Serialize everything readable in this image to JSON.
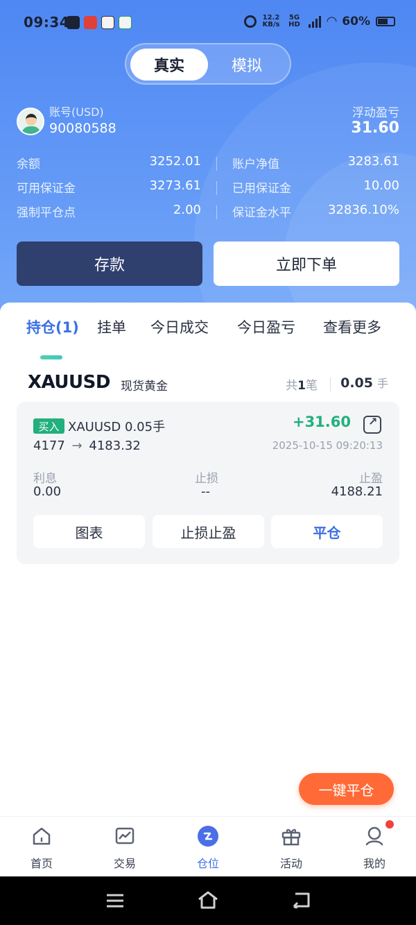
{
  "status_bar": {
    "time": "09:34",
    "speed_top": "12.2",
    "speed_unit": "KB/s",
    "network": "5G HD",
    "battery": "60%"
  },
  "mode_toggle": {
    "active": "真实",
    "inactive": "模拟"
  },
  "account": {
    "label": "账号(USD)",
    "number": "90080588",
    "floating_pnl_label": "浮动盈亏",
    "floating_pnl_value": "31.60"
  },
  "stats": [
    {
      "left_label": "余额",
      "left_value": "3252.01",
      "right_label": "账户净值",
      "right_value": "3283.61"
    },
    {
      "left_label": "可用保证金",
      "left_value": "3273.61",
      "right_label": "已用保证金",
      "right_value": "10.00"
    },
    {
      "left_label": "强制平仓点",
      "left_value": "2.00",
      "right_label": "保证金水平",
      "right_value": "32836.10%"
    }
  ],
  "actions": {
    "deposit": "存款",
    "place_order": "立即下单"
  },
  "tabs": [
    {
      "label": "持仓(1)",
      "active": true
    },
    {
      "label": "挂单",
      "active": false
    },
    {
      "label": "今日成交",
      "active": false
    },
    {
      "label": "今日盈亏",
      "active": false
    },
    {
      "label": "查看更多",
      "active": false
    }
  ],
  "symbol_group": {
    "symbol": "XAUUSD",
    "description": "现货黄金",
    "count_prefix": "共",
    "count": "1",
    "count_suffix": "笔",
    "lots": "0.05",
    "lots_unit": "手"
  },
  "position": {
    "side": "买入",
    "symbol_lots": "XAUUSD  0.05手",
    "price_from": "4177",
    "arrow": "→",
    "price_to": "4183.32",
    "profit": "+31.60",
    "time": "2025-10-15 09:20:13",
    "interest_label": "利息",
    "interest_value": "0.00",
    "stop_loss_label": "止损",
    "stop_loss_value": "--",
    "take_profit_label": "止盈",
    "take_profit_value": "4188.21",
    "btn_chart": "图表",
    "btn_sltp": "止损止盈",
    "btn_close": "平仓"
  },
  "close_all": "一键平仓",
  "bottom_nav": [
    {
      "label": "首页",
      "icon": "home-icon",
      "active": false
    },
    {
      "label": "交易",
      "icon": "trade-chart-icon",
      "active": false
    },
    {
      "label": "仓位",
      "icon": "position-icon",
      "active": true
    },
    {
      "label": "活动",
      "icon": "gift-icon",
      "active": false
    },
    {
      "label": "我的",
      "icon": "profile-icon",
      "active": false
    }
  ],
  "colors": {
    "accent": "#3c6fe6",
    "buy": "#22b07d",
    "close_all": "#ff6a36",
    "deposit": "#2f3f6e"
  }
}
